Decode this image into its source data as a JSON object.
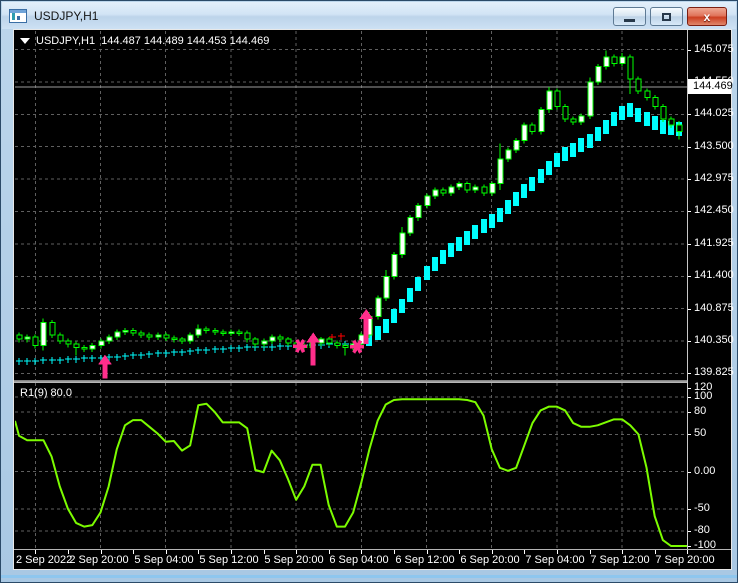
{
  "window": {
    "title": "USDJPY,H1",
    "close_glyph": "x"
  },
  "header": {
    "symbol_period": "USDJPY,H1",
    "quote": "144.487 144.489 144.453 144.469"
  },
  "price_axis": {
    "labels": [
      {
        "text": "145.075",
        "value": 145.075
      },
      {
        "text": "144.550",
        "value": 144.55
      },
      {
        "text": "144.025",
        "value": 144.025
      },
      {
        "text": "143.500",
        "value": 143.5
      },
      {
        "text": "142.975",
        "value": 142.975
      },
      {
        "text": "142.450",
        "value": 142.45
      },
      {
        "text": "141.925",
        "value": 141.925
      },
      {
        "text": "141.400",
        "value": 141.4
      },
      {
        "text": "140.875",
        "value": 140.875
      },
      {
        "text": "140.350",
        "value": 140.35
      },
      {
        "text": "139.825",
        "value": 139.825
      }
    ],
    "current": {
      "text": "144.469",
      "value": 144.469
    }
  },
  "indicator": {
    "label": "R1(9) 80.0",
    "axis": [
      {
        "text": "120",
        "value": 120,
        "grid": false
      },
      {
        "text": "100",
        "value": 100,
        "grid": true
      },
      {
        "text": "80",
        "value": 80,
        "grid": true
      },
      {
        "text": "50",
        "value": 50,
        "grid": true
      },
      {
        "text": "0.00",
        "value": 0,
        "grid": true
      },
      {
        "text": "-50",
        "value": -50,
        "grid": true
      },
      {
        "text": "-80",
        "value": -80,
        "grid": true
      },
      {
        "text": "-100",
        "value": -100,
        "grid": false
      }
    ]
  },
  "time_axis": {
    "labels": [
      {
        "bar": 2,
        "text": "2 Sep 2022"
      },
      {
        "bar": 10,
        "text": "2 Sep 20:00"
      },
      {
        "bar": 18,
        "text": "5 Sep 04:00"
      },
      {
        "bar": 26,
        "text": "5 Sep 12:00"
      },
      {
        "bar": 34,
        "text": "5 Sep 20:00"
      },
      {
        "bar": 42,
        "text": "6 Sep 04:00"
      },
      {
        "bar": 50,
        "text": "6 Sep 12:00"
      },
      {
        "bar": 58,
        "text": "6 Sep 20:00"
      },
      {
        "bar": 66,
        "text": "7 Sep 04:00"
      },
      {
        "bar": 74,
        "text": "7 Sep 12:00"
      },
      {
        "bar": 82,
        "text": "7 Sep 20:00"
      }
    ]
  },
  "chart_data": {
    "type": "candlestick-with-oscillator",
    "symbol": "USDJPY",
    "period": "H1",
    "candles": [
      [
        140.45,
        140.49,
        140.33,
        140.38
      ],
      [
        140.38,
        140.46,
        140.33,
        140.42
      ],
      [
        140.42,
        140.46,
        140.23,
        140.28
      ],
      [
        140.28,
        140.72,
        140.2,
        140.65
      ],
      [
        140.65,
        140.69,
        140.4,
        140.45
      ],
      [
        140.45,
        140.49,
        140.3,
        140.35
      ],
      [
        140.35,
        140.39,
        140.25,
        140.3
      ],
      [
        140.3,
        140.34,
        140.12,
        140.25
      ],
      [
        140.25,
        140.29,
        140.17,
        140.22
      ],
      [
        140.22,
        140.32,
        140.17,
        140.28
      ],
      [
        140.28,
        140.39,
        140.23,
        140.35
      ],
      [
        140.35,
        140.46,
        140.3,
        140.42
      ],
      [
        140.42,
        140.54,
        140.37,
        140.5
      ],
      [
        140.5,
        140.56,
        140.45,
        140.52
      ],
      [
        140.52,
        140.56,
        140.43,
        140.48
      ],
      [
        140.48,
        140.52,
        140.4,
        140.45
      ],
      [
        140.45,
        140.49,
        140.37,
        140.42
      ],
      [
        140.42,
        140.49,
        140.37,
        140.45
      ],
      [
        140.45,
        140.49,
        140.35,
        140.4
      ],
      [
        140.4,
        140.44,
        140.33,
        140.38
      ],
      [
        140.38,
        140.42,
        140.3,
        140.35
      ],
      [
        140.35,
        140.49,
        140.3,
        140.45
      ],
      [
        140.45,
        140.62,
        140.4,
        140.55
      ],
      [
        140.55,
        140.59,
        140.47,
        140.52
      ],
      [
        140.52,
        140.56,
        140.45,
        140.5
      ],
      [
        140.5,
        140.54,
        140.43,
        140.48
      ],
      [
        140.48,
        140.54,
        140.43,
        140.5
      ],
      [
        140.5,
        140.54,
        140.43,
        140.48
      ],
      [
        140.48,
        140.52,
        140.33,
        140.38
      ],
      [
        140.38,
        140.42,
        140.25,
        140.3
      ],
      [
        140.3,
        140.39,
        140.25,
        140.35
      ],
      [
        140.35,
        140.46,
        140.3,
        140.42
      ],
      [
        140.42,
        140.46,
        140.33,
        140.38
      ],
      [
        140.38,
        140.42,
        140.27,
        140.32
      ],
      [
        140.32,
        140.36,
        140.23,
        140.28
      ],
      [
        140.28,
        140.32,
        140.2,
        140.25
      ],
      [
        140.25,
        140.36,
        140.2,
        140.32
      ],
      [
        140.32,
        140.42,
        140.27,
        140.38
      ],
      [
        140.38,
        140.42,
        140.27,
        140.32
      ],
      [
        140.32,
        140.36,
        140.23,
        140.28
      ],
      [
        140.28,
        140.32,
        140.12,
        140.25
      ],
      [
        140.25,
        140.34,
        140.2,
        140.3
      ],
      [
        140.3,
        140.49,
        140.25,
        140.45
      ],
      [
        140.45,
        140.82,
        140.4,
        140.75
      ],
      [
        140.75,
        141.09,
        140.7,
        141.05
      ],
      [
        141.05,
        141.5,
        141.0,
        141.4
      ],
      [
        141.4,
        141.79,
        141.35,
        141.75
      ],
      [
        141.75,
        142.2,
        141.7,
        142.1
      ],
      [
        142.1,
        142.39,
        142.05,
        142.35
      ],
      [
        142.35,
        142.59,
        142.3,
        142.55
      ],
      [
        142.55,
        142.74,
        142.5,
        142.7
      ],
      [
        142.7,
        142.84,
        142.65,
        142.8
      ],
      [
        142.8,
        142.84,
        142.7,
        142.75
      ],
      [
        142.75,
        142.89,
        142.7,
        142.85
      ],
      [
        142.85,
        142.94,
        142.8,
        142.9
      ],
      [
        142.9,
        142.94,
        142.75,
        142.8
      ],
      [
        142.8,
        142.89,
        142.75,
        142.85
      ],
      [
        142.85,
        142.89,
        142.7,
        142.75
      ],
      [
        142.75,
        142.94,
        142.7,
        142.9
      ],
      [
        142.9,
        143.55,
        142.8,
        143.3
      ],
      [
        143.3,
        143.49,
        143.25,
        143.45
      ],
      [
        143.45,
        143.64,
        143.4,
        143.6
      ],
      [
        143.6,
        143.89,
        143.55,
        143.85
      ],
      [
        143.85,
        143.89,
        143.7,
        143.75
      ],
      [
        143.75,
        144.14,
        143.7,
        144.1
      ],
      [
        144.1,
        144.47,
        144.05,
        144.4
      ],
      [
        144.4,
        144.44,
        144.1,
        144.15
      ],
      [
        144.15,
        144.19,
        143.9,
        143.95
      ],
      [
        143.95,
        143.99,
        143.85,
        143.9
      ],
      [
        143.9,
        144.04,
        143.85,
        144.0
      ],
      [
        144.0,
        144.62,
        143.95,
        144.55
      ],
      [
        144.55,
        144.84,
        144.5,
        144.8
      ],
      [
        144.8,
        145.06,
        144.75,
        144.95
      ],
      [
        144.95,
        144.99,
        144.8,
        144.85
      ],
      [
        144.85,
        145.02,
        144.8,
        144.95
      ],
      [
        144.95,
        144.99,
        144.35,
        144.6
      ],
      [
        144.6,
        144.64,
        144.35,
        144.4
      ],
      [
        144.4,
        144.44,
        144.25,
        144.3
      ],
      [
        144.3,
        144.34,
        144.1,
        144.15
      ],
      [
        144.15,
        144.19,
        143.9,
        143.95
      ],
      [
        143.95,
        143.99,
        143.8,
        143.85
      ],
      [
        143.85,
        143.92,
        143.62,
        143.75
      ]
    ],
    "trail": {
      "cross_values": [
        140.02,
        140.03,
        140.03,
        140.04,
        140.05,
        140.05,
        140.06,
        140.06,
        140.07,
        140.08,
        140.08,
        140.09,
        140.1,
        140.11,
        140.12,
        140.13,
        140.14,
        140.15,
        140.16,
        140.17,
        140.18,
        140.19,
        140.2,
        140.21,
        140.22,
        140.23,
        140.24,
        140.24,
        140.25,
        140.25,
        140.26,
        140.26,
        140.27,
        140.27,
        140.28,
        140.28,
        140.29,
        140.29,
        140.3,
        140.3,
        140.3,
        140.31,
        140.32
      ],
      "bar_values": [
        140.38,
        140.48,
        140.6,
        140.75,
        140.92,
        141.1,
        141.28,
        141.45,
        141.6,
        141.72,
        141.83,
        141.93,
        142.02,
        142.12,
        142.22,
        142.3,
        142.4,
        142.52,
        142.65,
        142.78,
        142.9,
        143.02,
        143.15,
        143.28,
        143.38,
        143.45,
        143.52,
        143.6,
        143.7,
        143.82,
        143.95,
        144.05,
        144.1,
        144.02,
        143.95,
        143.88,
        143.82,
        143.8,
        143.78
      ],
      "red_crosses": [
        {
          "bar": 38.4,
          "price": 140.42
        },
        {
          "bar": 39.5,
          "price": 140.44
        }
      ]
    },
    "signals": {
      "stars": [
        {
          "bar": 34.5,
          "price": 140.27
        },
        {
          "bar": 41.5,
          "price": 140.26
        }
      ],
      "arrows": [
        {
          "bar": 10.55,
          "price": 140.13,
          "len": 24
        },
        {
          "bar": 36.1,
          "price": 140.49,
          "len": 33
        },
        {
          "bar": 42.6,
          "price": 140.87,
          "len": 35
        }
      ]
    },
    "oscillator": {
      "name": "R1(9)",
      "edge_start": 68,
      "edge_end": -100,
      "values": [
        48,
        42,
        42,
        42,
        20,
        -20,
        -50,
        -69,
        -74,
        -72,
        -55,
        -20,
        30,
        62,
        69,
        69,
        60,
        51,
        40,
        41,
        28,
        35,
        89,
        91,
        80,
        66,
        66,
        66,
        58,
        2,
        -1,
        28,
        15,
        -10,
        -38,
        -20,
        9,
        9,
        -45,
        -74,
        -74,
        -55,
        -15,
        30,
        68,
        90,
        96,
        97,
        97,
        97,
        97,
        97,
        97,
        97,
        97,
        96,
        93,
        75,
        30,
        5,
        1,
        5,
        35,
        65,
        82,
        87,
        87,
        82,
        65,
        60,
        60,
        62,
        66,
        70,
        70,
        62,
        50,
        5,
        -60,
        -92,
        -100,
        -100
      ]
    },
    "colors": {
      "background": "#000000",
      "grid": "#5f5f5f",
      "bull_fill": "#ffffff",
      "bear_fill": "#000000",
      "candle_outline": "#00ff00",
      "trail": "#00ffff",
      "signal": "#ff2e8b",
      "alert_cross": "#ff0000",
      "oscillator": "#7cfc00",
      "axis_text": "#ffffff",
      "price_line": "#9c9c9c",
      "current_price_bg": "#ffffff"
    }
  }
}
